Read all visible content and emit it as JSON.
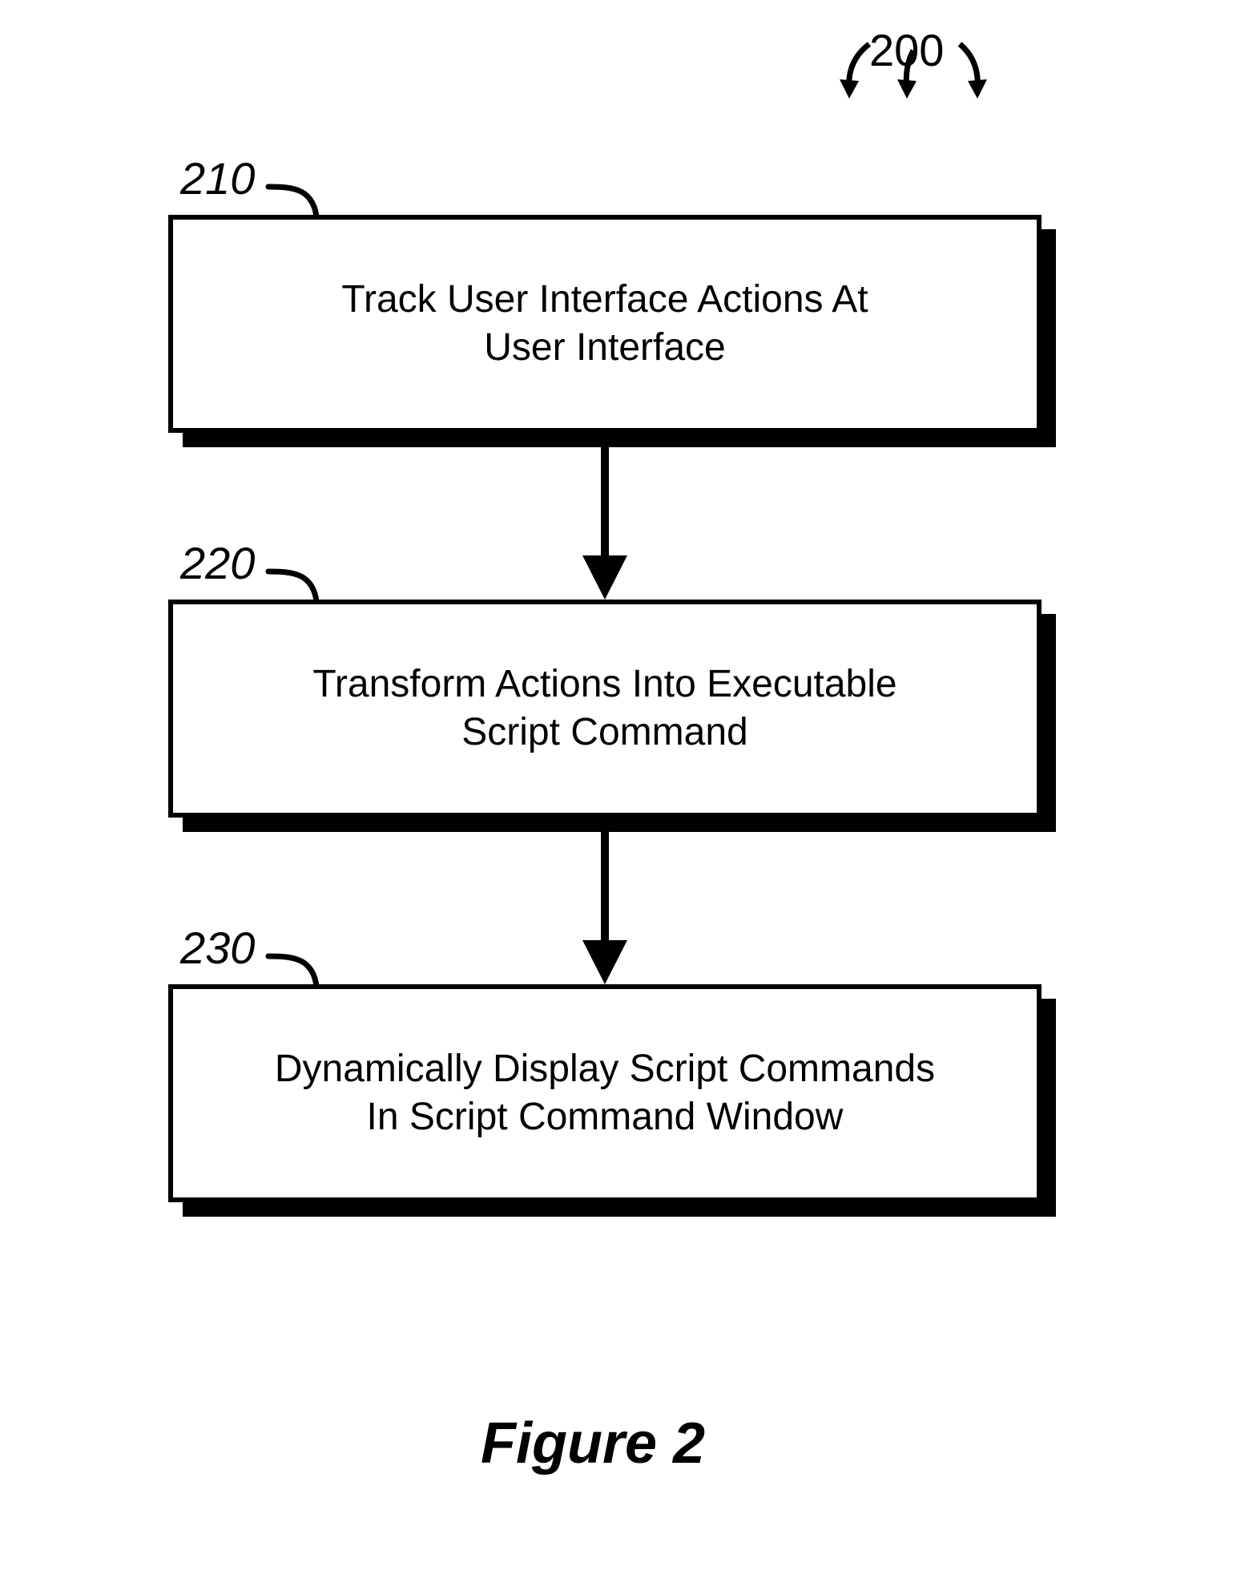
{
  "figure": {
    "caption": "Figure 2",
    "flow_ref": "200",
    "steps": [
      {
        "ref": "210",
        "text": "Track User Interface Actions At\nUser Interface"
      },
      {
        "ref": "220",
        "text": "Transform Actions Into Executable\nScript Command"
      },
      {
        "ref": "230",
        "text": "Dynamically Display Script Commands\nIn Script Command Window"
      }
    ]
  }
}
